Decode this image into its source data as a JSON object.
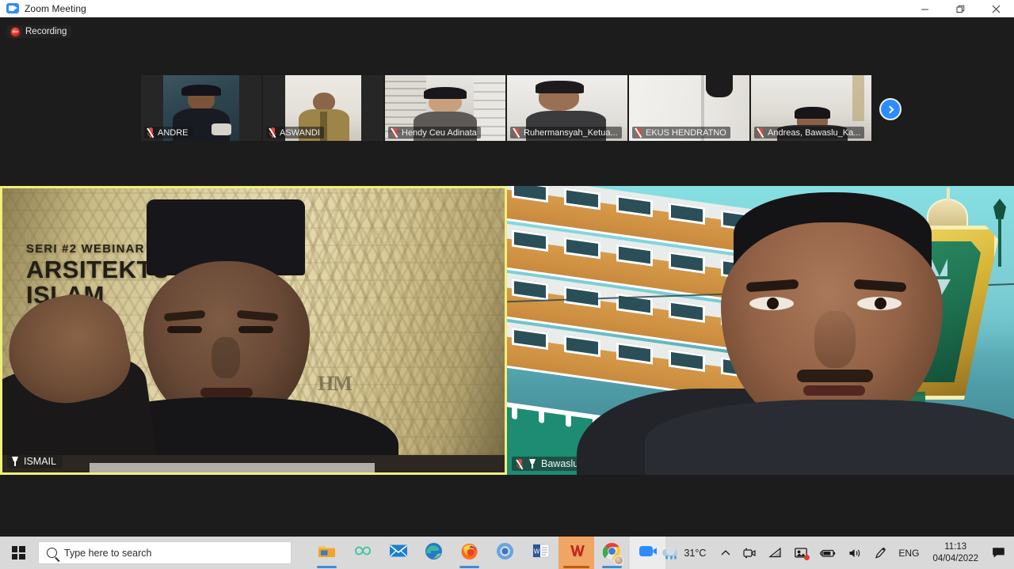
{
  "window": {
    "title": "Zoom Meeting",
    "icon": "zoom-icon",
    "minimize_label": "Minimize",
    "restore_label": "Restore",
    "close_label": "Close"
  },
  "meeting": {
    "recording_label": "Recording",
    "next_page_label": "Next page",
    "active_speaker_border_color": "#f0f07a",
    "thumbnails": [
      {
        "name": "ANDRE",
        "muted": true
      },
      {
        "name": "ASWANDI",
        "muted": true
      },
      {
        "name": "Hendy Ceu Adinata",
        "muted": true
      },
      {
        "name": "Ruhermansyah_Ketua...",
        "muted": true
      },
      {
        "name": "EKUS HENDRATNO",
        "muted": true
      },
      {
        "name": "Andreas, Bawaslu_Ka...",
        "muted": true
      }
    ],
    "main_videos": [
      {
        "name": "ISMAIL",
        "muted": false,
        "pinned": true,
        "active_speaker": true,
        "background_text": {
          "line1": "SERI #2 WEBINAR",
          "line2": "ARSITEKTU",
          "line3": "ISLAM",
          "watermark": "HM"
        }
      },
      {
        "name": "Bawaslu Kabupaten Sekadau Official",
        "muted": true,
        "pinned": true,
        "active_speaker": false,
        "background_text": {
          "banner": "I LOVE SEK"
        }
      }
    ]
  },
  "taskbar": {
    "start_label": "Start",
    "search": {
      "placeholder": "Type here to search",
      "value": ""
    },
    "apps": [
      {
        "name": "file-explorer",
        "label": "File Explorer",
        "running": true
      },
      {
        "name": "office-loop",
        "label": "Microsoft Loop",
        "running": false
      },
      {
        "name": "mail",
        "label": "Mail",
        "running": false
      },
      {
        "name": "microsoft-edge",
        "label": "Microsoft Edge",
        "running": false
      },
      {
        "name": "firefox",
        "label": "Mozilla Firefox",
        "running": true
      },
      {
        "name": "chromium",
        "label": "Chromium",
        "running": false
      },
      {
        "name": "microsoft-word",
        "label": "Microsoft Word",
        "running": false
      },
      {
        "name": "wps-office",
        "label": "WPS Office",
        "running": true,
        "highlight": true
      },
      {
        "name": "google-chrome",
        "label": "Google Chrome",
        "running": true
      },
      {
        "name": "zoom",
        "label": "Zoom",
        "running": true,
        "active": true
      }
    ],
    "tray": {
      "weather_temp": "31°C",
      "weather_icon": "rain-cloud-icon",
      "overflow_label": "Show hidden icons",
      "icons": [
        "camera-icon",
        "wifi-icon",
        "zoom-screen-share-icon",
        "battery-icon",
        "volume-icon",
        "pen-icon"
      ],
      "language": "ENG",
      "time": "11:13",
      "date": "04/04/2022",
      "notifications_label": "Notifications"
    }
  }
}
